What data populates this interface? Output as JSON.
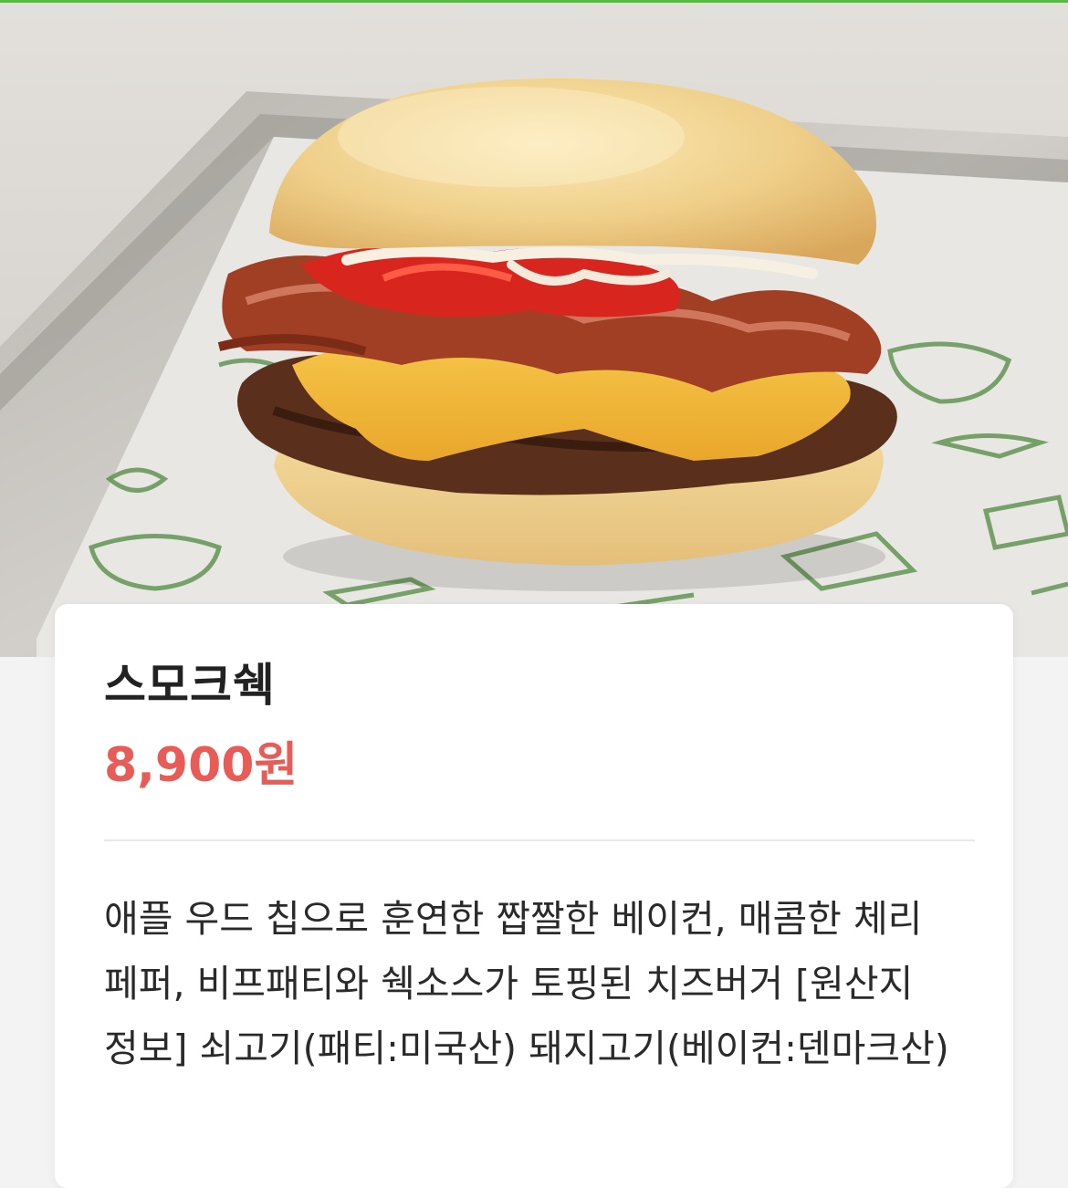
{
  "product": {
    "name": "스모크쉑",
    "price": "8,900원",
    "description": "애플 우드 칩으로 훈연한 짭짤한 베이컨, 매콤한 체리 페퍼, 비프패티와 쉑소스가 토핑된 치즈버거 [원산지 정보] 쇠고기(패티:미국산) 돼지고기(베이컨:덴마크산)"
  },
  "colors": {
    "accent": "#5ab845",
    "price": "#e85b57",
    "title": "#222222"
  }
}
